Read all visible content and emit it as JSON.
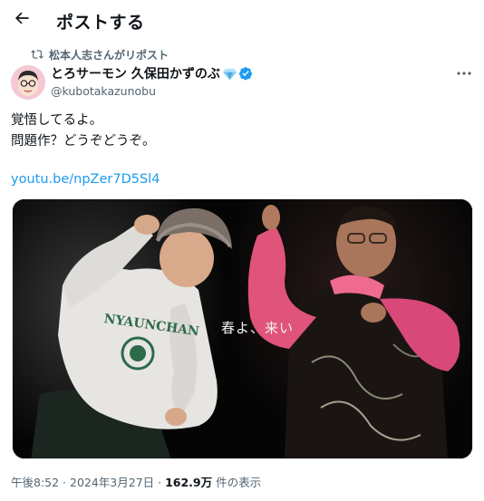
{
  "header": {
    "title": "ポストする"
  },
  "repost": {
    "text": "松本人志さんがリポスト"
  },
  "author": {
    "name": "とろサーモン 久保田かずのぶ",
    "handle": "@kubotakazunobu"
  },
  "tweet": {
    "lines": [
      "覚悟してるよ。",
      "問題作？どうぞどうぞ。"
    ],
    "link": "youtu.be/npZer7D5Sl4"
  },
  "media": {
    "caption": "春よ、来い"
  },
  "meta": {
    "time": "午後8:52 · 2024年3月27日 · ",
    "views": "162.9万",
    "views_suffix": " 件の表示"
  },
  "colors": {
    "accent": "#1d9bf0",
    "text": "#0f1419",
    "muted": "#536471"
  },
  "icons": [
    "back-arrow-icon",
    "repost-icon",
    "diamond-icon",
    "verified-badge-icon",
    "more-icon"
  ]
}
